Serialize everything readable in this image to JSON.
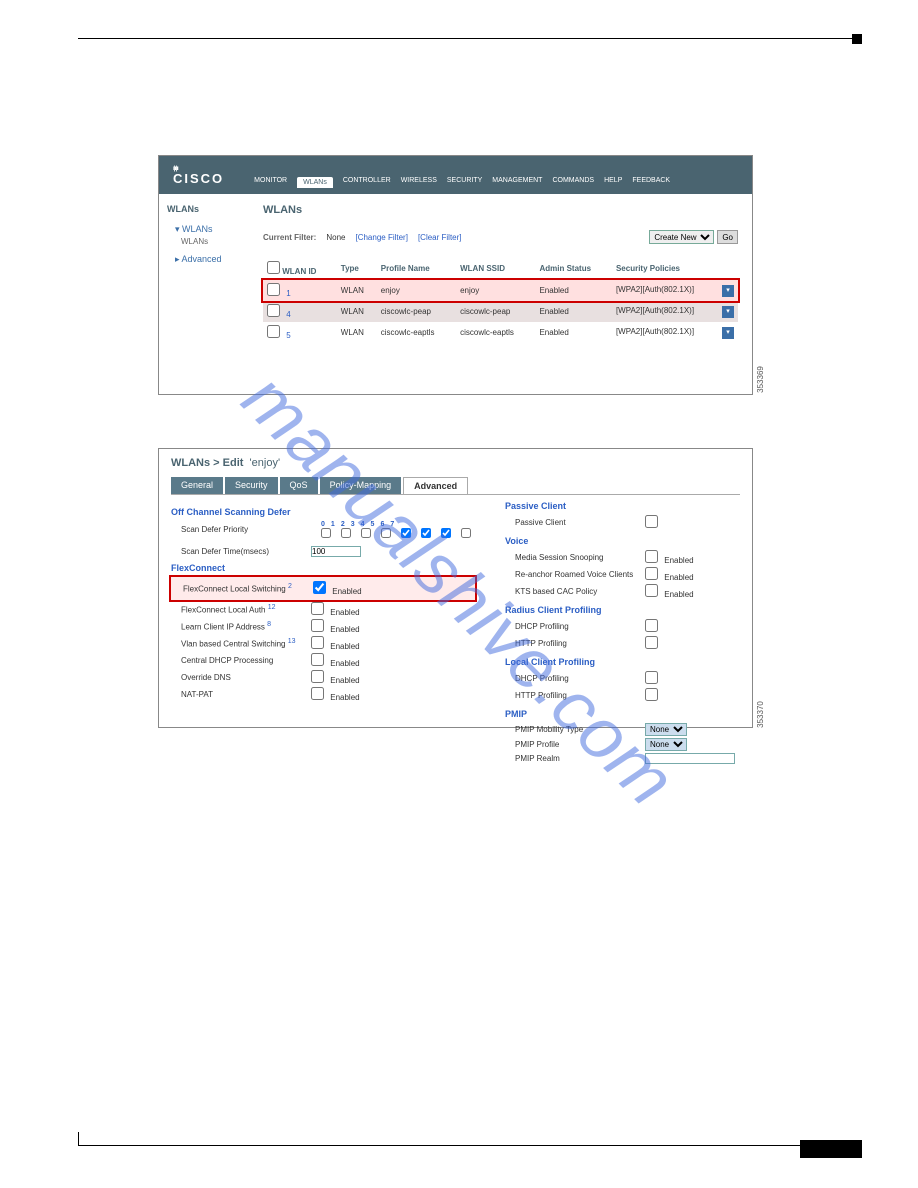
{
  "watermark": "manualshive.com",
  "fig1": {
    "brand": "CISCO",
    "menu": [
      "MONITOR",
      "WLANs",
      "CONTROLLER",
      "WIRELESS",
      "SECURITY",
      "MANAGEMENT",
      "COMMANDS",
      "HELP",
      "FEEDBACK"
    ],
    "side_head": "WLANs",
    "side_items": [
      "WLANs",
      "WLANs",
      "Advanced"
    ],
    "title": "WLANs",
    "filter_label": "Current Filter:",
    "filter_value": "None",
    "change_filter": "[Change Filter]",
    "clear_filter": "[Clear Filter]",
    "create_new": "Create New",
    "go": "Go",
    "cols": [
      "WLAN ID",
      "Type",
      "Profile Name",
      "WLAN SSID",
      "Admin Status",
      "Security Policies"
    ],
    "rows": [
      {
        "id": "1",
        "type": "WLAN",
        "profile": "enjoy",
        "ssid": "enjoy",
        "status": "Enabled",
        "sec": "[WPA2][Auth(802.1X)]"
      },
      {
        "id": "4",
        "type": "WLAN",
        "profile": "ciscowlc-peap",
        "ssid": "ciscowlc-peap",
        "status": "Enabled",
        "sec": "[WPA2][Auth(802.1X)]"
      },
      {
        "id": "5",
        "type": "WLAN",
        "profile": "ciscowlc-eaptls",
        "ssid": "ciscowlc-eaptls",
        "status": "Enabled",
        "sec": "[WPA2][Auth(802.1X)]"
      }
    ]
  },
  "fig2": {
    "breadcrumb_pre": "WLANs > Edit",
    "breadcrumb_name": "'enjoy'",
    "tabs": [
      "General",
      "Security",
      "QoS",
      "Policy-Mapping",
      "Advanced"
    ],
    "active_tab": 4,
    "left": {
      "sec_off": "Off Channel Scanning Defer",
      "scan_prio": "Scan Defer Priority",
      "prio_nums": [
        "0",
        "1",
        "2",
        "3",
        "4",
        "5",
        "6",
        "7"
      ],
      "scan_time": "Scan Defer Time(msecs)",
      "scan_time_val": "100",
      "sec_flex": "FlexConnect",
      "flex_local_sw": "FlexConnect Local Switching",
      "flex_local_sw_sup": "2",
      "enabled": "Enabled",
      "flex_local_auth": "FlexConnect Local Auth",
      "flex_local_auth_sup": "12",
      "learn_ip": "Learn Client IP Address",
      "learn_ip_sup": "8",
      "vlan_central": "Vlan based Central Switching",
      "vlan_central_sup": "13",
      "central_dhcp": "Central DHCP Processing",
      "override_dns": "Override DNS",
      "nat_pat": "NAT-PAT"
    },
    "right": {
      "sec_passive": "Passive Client",
      "passive_client": "Passive Client",
      "sec_voice": "Voice",
      "media_snoop": "Media Session Snooping",
      "reanchor": "Re-anchor Roamed Voice Clients",
      "kts": "KTS based CAC Policy",
      "sec_radius": "Radius Client Profiling",
      "dhcp_prof": "DHCP Profiling",
      "http_prof": "HTTP Profiling",
      "sec_local": "Local Client Profiling",
      "sec_pmip": "PMIP",
      "pmip_mob": "PMIP Mobility Type",
      "pmip_profile": "PMIP Profile",
      "pmip_realm": "PMIP Realm",
      "none": "None",
      "enabled": "Enabled"
    }
  },
  "side_ids": {
    "fig1": "353369",
    "fig2": "353370"
  }
}
